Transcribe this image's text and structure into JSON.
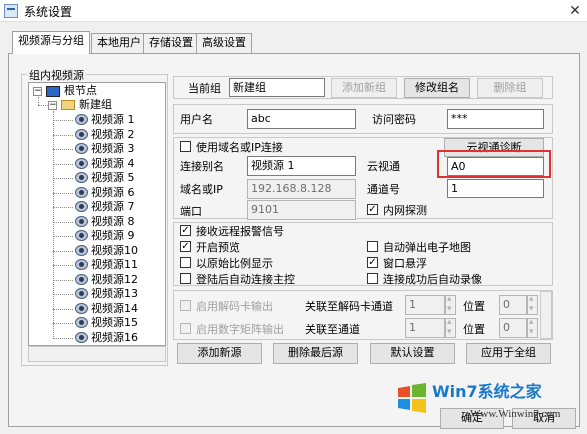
{
  "window": {
    "title": "系统设置",
    "close_glyph": "✕"
  },
  "tabs": [
    "视频源与分组",
    "本地用户",
    "存储设置",
    "高级设置"
  ],
  "group_box": {
    "label": "组内视频源"
  },
  "tree": {
    "root": "根节点",
    "group": "新建组",
    "sources": [
      "视频源 1",
      "视频源 2",
      "视频源 3",
      "视频源 4",
      "视频源 5",
      "视频源 6",
      "视频源 7",
      "视频源 8",
      "视频源 9",
      "视频源10",
      "视频源11",
      "视频源12",
      "视频源13",
      "视频源14",
      "视频源15",
      "视频源16"
    ]
  },
  "group_bar": {
    "current_group_label": "当前组",
    "current_group_value": "新建组",
    "add_group": "添加新组",
    "rename_group": "修改组名",
    "delete_group": "删除组"
  },
  "login": {
    "user_label": "用户名",
    "user_value": "abc",
    "password_label": "访问密码",
    "password_value": "***"
  },
  "connection": {
    "use_domain_ip": "使用域名或IP连接",
    "cloud_diag": "云视通诊断",
    "alias_label": "连接别名",
    "alias_value": "视频源 1",
    "cloud_label": "云视通",
    "cloud_value": "A0",
    "domain_label": "域名或IP",
    "domain_value": "192.168.8.128",
    "channel_label": "通道号",
    "channel_value": "1",
    "port_label": "端口",
    "port_value": "9101",
    "lan_detect": "内网探测"
  },
  "options": {
    "receive_alarm": "接收远程报警信号",
    "auto_emap": "自动弹出电子地图",
    "enable_preview": "开启预览",
    "window_float": "窗口悬浮",
    "original_ratio": "以原始比例显示",
    "auto_record": "连接成功后自动录像",
    "auto_connect_main": "登陆后自动连接主控"
  },
  "output": {
    "decoder_out": "启用解码卡输出",
    "decoder_channel_label": "关联至解码卡通道",
    "decoder_channel_value": "1",
    "position_label": "位置",
    "position_value": "0",
    "matrix_out": "启用数字矩阵输出",
    "matrix_channel_label": "关联至通道",
    "matrix_channel_value": "1",
    "matrix_position_label": "位置",
    "matrix_position_value": "0"
  },
  "bottom_buttons": {
    "add_source": "添加新源",
    "delete_last": "删除最后源",
    "defaults": "默认设置",
    "apply_all": "应用于全组"
  },
  "dialog_buttons": {
    "ok": "确定",
    "cancel": "取消"
  },
  "watermark": {
    "brand": "Win7系统之家",
    "url": "Www.Winwin7.com"
  },
  "colors": {
    "highlight_box": "#e03232",
    "tree_icon": "#2b66c8",
    "folder": "#f2d27a"
  },
  "icons": [
    "window-icon",
    "monitor-icon",
    "folder-icon",
    "camera-icon",
    "windows-logo-icon"
  ],
  "checks": {
    "use_domain_ip": false,
    "lan_detect": true,
    "receive_alarm": true,
    "auto_emap": false,
    "enable_preview": true,
    "window_float": true,
    "original_ratio": false,
    "auto_record": false,
    "auto_connect_main": false,
    "decoder_out": false,
    "matrix_out": false
  }
}
